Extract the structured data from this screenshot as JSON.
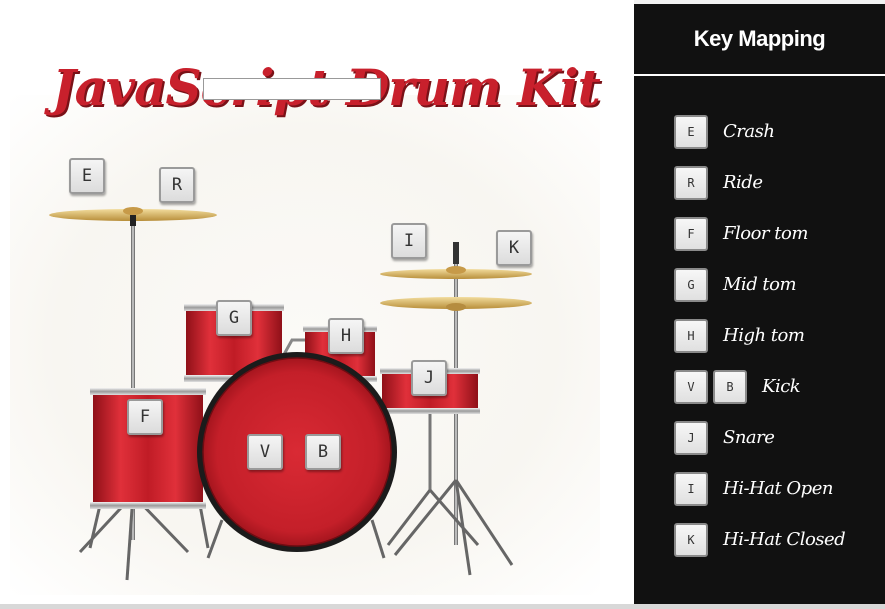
{
  "app": {
    "title": "JavaScript Drum Kit"
  },
  "kit_keys": {
    "crash": "E",
    "ride": "R",
    "hihat_open": "I",
    "hihat_closed": "K",
    "mid_tom": "G",
    "high_tom": "H",
    "floor_tom": "F",
    "kick_1": "V",
    "kick_2": "B",
    "snare": "J"
  },
  "sidebar": {
    "title": "Key Mapping",
    "items": [
      {
        "keys": [
          "E"
        ],
        "label": "Crash"
      },
      {
        "keys": [
          "R"
        ],
        "label": "Ride"
      },
      {
        "keys": [
          "F"
        ],
        "label": "Floor tom"
      },
      {
        "keys": [
          "G"
        ],
        "label": "Mid tom"
      },
      {
        "keys": [
          "H"
        ],
        "label": "High tom"
      },
      {
        "keys": [
          "V",
          "B"
        ],
        "label": "Kick"
      },
      {
        "keys": [
          "J"
        ],
        "label": "Snare"
      },
      {
        "keys": [
          "I"
        ],
        "label": "Hi-Hat Open"
      },
      {
        "keys": [
          "K"
        ],
        "label": "Hi-Hat Closed"
      }
    ]
  },
  "colors": {
    "drum_red": "#d3222e",
    "title_red": "#c8202c",
    "cymbal_gold": "#d9b868",
    "sidebar_bg": "#111111"
  }
}
